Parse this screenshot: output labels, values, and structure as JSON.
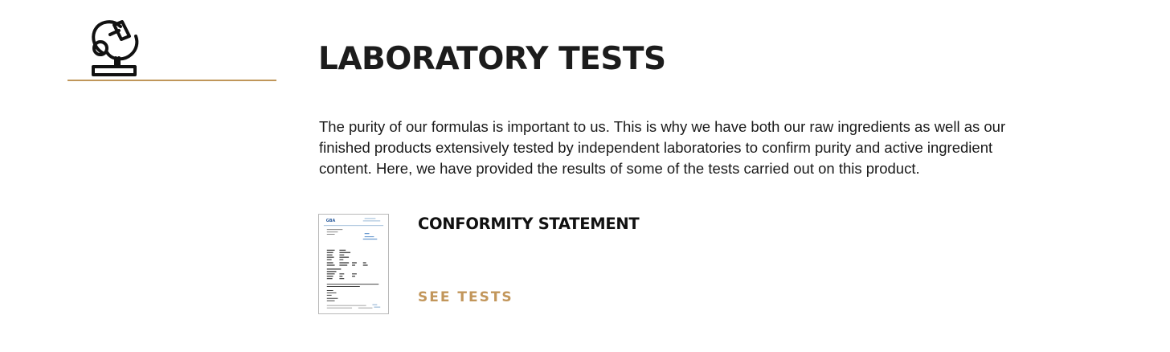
{
  "section": {
    "icon": "microscope-icon",
    "accent_color": "#c0965a",
    "title": "LABORATORY TESTS",
    "intro": "The purity of our formulas is important to us. This is why we have both our raw ingredients as well as our finished products extensively tested by independent laboratories to confirm purity and active ingredient content. Here, we have provided the results of some of the tests carried out on this product."
  },
  "tests": [
    {
      "thumbnail": "document-thumbnail",
      "thumbnail_logo": "GBA",
      "name": "CONFORMITY STATEMENT",
      "link_label": "SEE TESTS",
      "link_color": "#c2965b"
    }
  ]
}
